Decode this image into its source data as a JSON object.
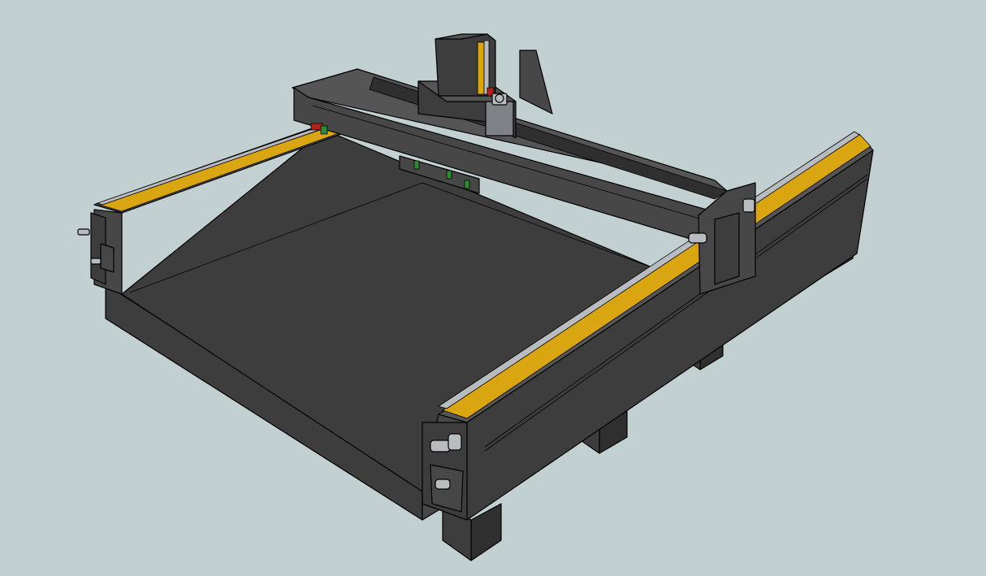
{
  "viewport": {
    "background": "#c3d0d1"
  },
  "colors": {
    "dark": "#3d3d3d",
    "mid": "#474747",
    "light": "#555555",
    "deep": "#2f2f2f",
    "rail": "#d9a510",
    "steel": "#b9bcbf",
    "steel_shadow": "#7e8186",
    "accent_red": "#b0221d",
    "accent_green": "#2d8a33"
  },
  "model": {
    "parts": [
      "base-frame",
      "work-table",
      "left-side-rail",
      "right-side-rail",
      "gantry-beam",
      "gantry-carriage",
      "z-axis-column",
      "spindle-motor",
      "gantry-right-end-plate",
      "support-legs"
    ]
  }
}
